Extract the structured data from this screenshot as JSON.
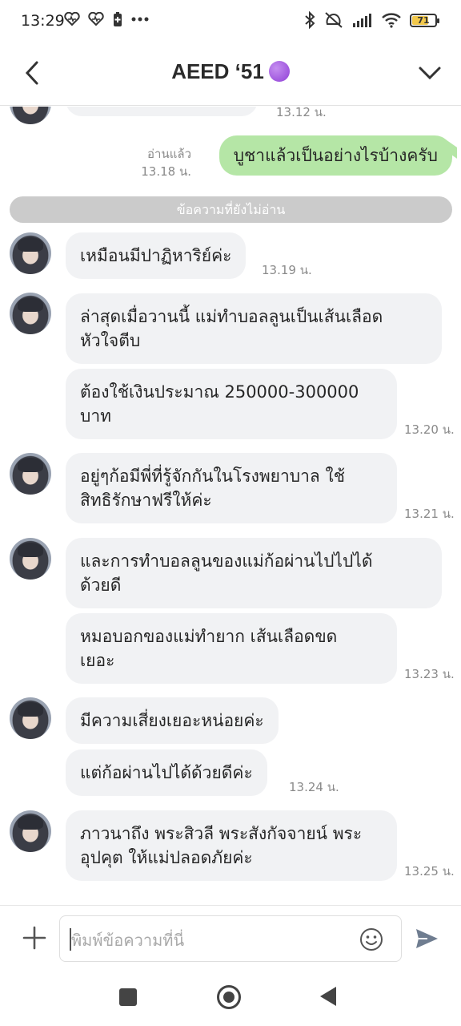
{
  "status_bar": {
    "time": "13:29",
    "battery_level": "71",
    "battery_color": "#f2c84b",
    "icons_left": [
      "heart-wave-icon",
      "heart-wave-icon",
      "battery-saver-icon",
      "more-dots-icon"
    ],
    "icons_right": [
      "bluetooth-icon",
      "vibrate-off-icon",
      "signal-icon",
      "wifi-icon",
      "battery-icon"
    ]
  },
  "header": {
    "title": "AEED ‘51",
    "title_emoji_color": "#8f3fd6",
    "back_icon": "chevron-left-icon",
    "menu_icon": "chevron-down-icon"
  },
  "chat": {
    "partial_top_time": "13.12 น.",
    "sent": {
      "read_label": "อ่านแล้ว",
      "time": "13.18 น.",
      "text": "บูชาแล้วเป็นอย่างไรบ้างครับ",
      "bubble_color": "#b5e6a6"
    },
    "unread_divider": "ข้อความที่ยังไม่อ่าน",
    "messages": [
      {
        "text": "เหมือนมีปาฏิหาริย์ค่ะ",
        "time": "13.19 น."
      },
      {
        "text": "ล่าสุดเมื่อวานนี้ แม่ทำบอลลูนเป็นเส้นเลือด\nหัวใจตีบ",
        "time": ""
      },
      {
        "text": "ต้องใช้เงินประมาณ 250000-300000\nบาท",
        "time": "13.20 น."
      },
      {
        "text": "อยู่ๆก้อมีพี่ที่รู้จักกันในโรงพยาบาล ใช้\nสิทธิรักษาฟรีให้ค่ะ",
        "time": "13.21 น."
      },
      {
        "text": "และการทำบอลลูนของแม่ก้อผ่านไปไปได้\nด้วยดี",
        "time": ""
      },
      {
        "text": "หมอบอกของแม่ทำยาก เส้นเลือดขด\nเยอะ",
        "time": "13.23 น."
      },
      {
        "text": "มีความเสี่ยงเยอะหน่อยค่ะ",
        "time": ""
      },
      {
        "text": "แต่ก้อผ่านไปได้ด้วยดีค่ะ",
        "time": "13.24 น."
      },
      {
        "text": "ภาวนาถึง พระสิวลี พระสังกัจจายน์ พระ\nอุปคุต ให้แม่ปลอดภัยค่ะ",
        "time": "13.25 น."
      }
    ]
  },
  "input": {
    "placeholder": "พิมพ์ข้อความที่นี่",
    "plus_icon": "plus-icon",
    "emoji_icon": "smiley-icon",
    "send_icon": "send-icon"
  },
  "nav": {
    "icons": [
      "recents-square-icon",
      "home-circle-icon",
      "back-triangle-icon"
    ]
  }
}
